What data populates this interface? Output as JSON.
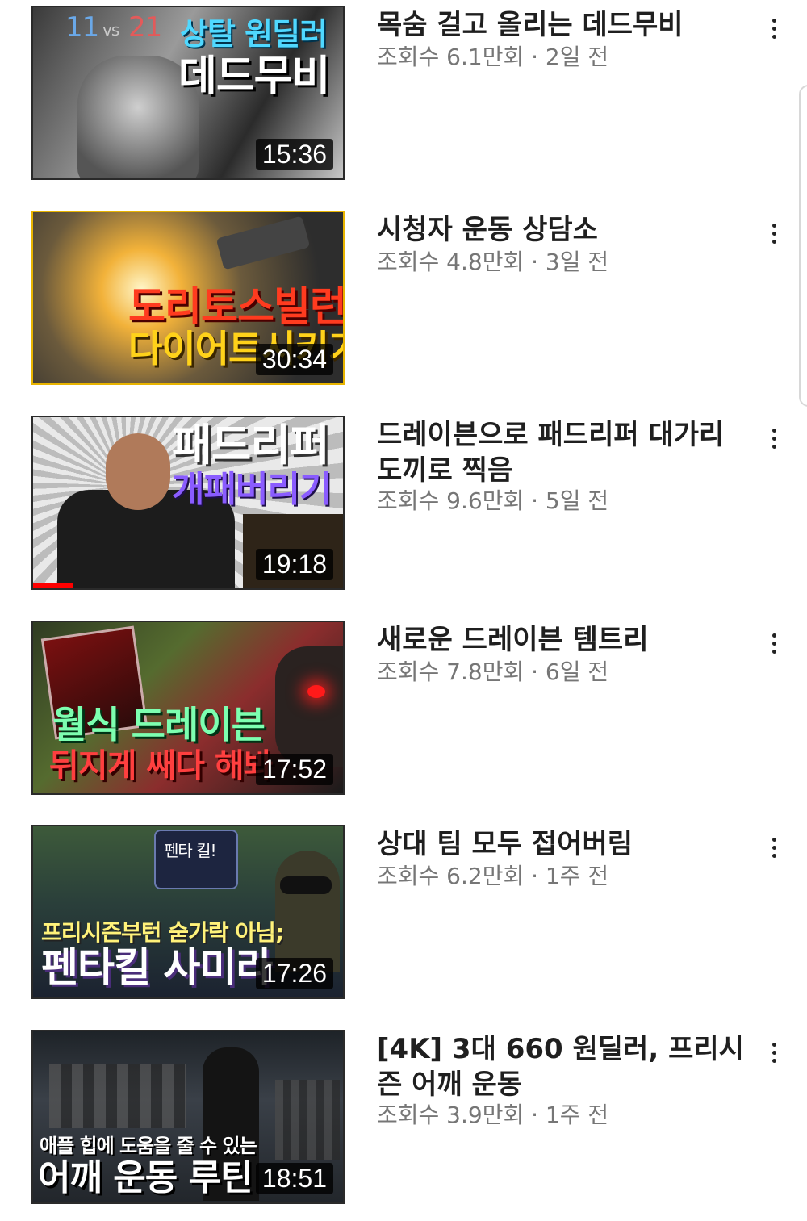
{
  "videos": [
    {
      "title": "목숨 걸고 올리는 데드무비",
      "meta": "조회수 6.1만회 · 2일 전",
      "duration": "15:36",
      "thumb_lines": [
        "11",
        "vs",
        "21",
        "상탈 원딜러",
        "데드무비"
      ]
    },
    {
      "title": "시청자 운동 상담소",
      "meta": "조회수 4.8만회 · 3일 전",
      "duration": "30:34",
      "thumb_lines": [
        "도리토스빌런",
        "다이어트시키기"
      ]
    },
    {
      "title": "드레이븐으로 패드리퍼 대가리 도끼로 찍음",
      "meta": "조회수 9.6만회 · 5일 전",
      "duration": "19:18",
      "watched_fraction": 0.13,
      "thumb_lines": [
        "패드리퍼",
        "개패버리기"
      ]
    },
    {
      "title": "새로운 드레이븐 템트리",
      "meta": "조회수 7.8만회 · 6일 전",
      "duration": "17:52",
      "thumb_lines": [
        "월식 드레이븐",
        "뒤지게 쌔다 해봐"
      ]
    },
    {
      "title": "상대 팀 모두 접어버림",
      "meta": "조회수 6.2만회 · 1주 전",
      "duration": "17:26",
      "thumb_lines": [
        "펜타 킬!",
        "프리시즌부턴 숟가락 아님;",
        "펜타킬 사미라"
      ]
    },
    {
      "title": "[4K] 3대 660 원딜러, 프리시즌 어깨 운동",
      "meta": "조회수 3.9만회 · 1주 전",
      "duration": "18:51",
      "thumb_lines": [
        "애플 힙에 도움을 줄 수 있는",
        "어깨 운동 루틴"
      ]
    }
  ],
  "icons": {
    "more": "more-vert-icon"
  },
  "colors": {
    "progress": "#ff0000",
    "meta_text": "#767676",
    "title_text": "#1f1f1f"
  }
}
